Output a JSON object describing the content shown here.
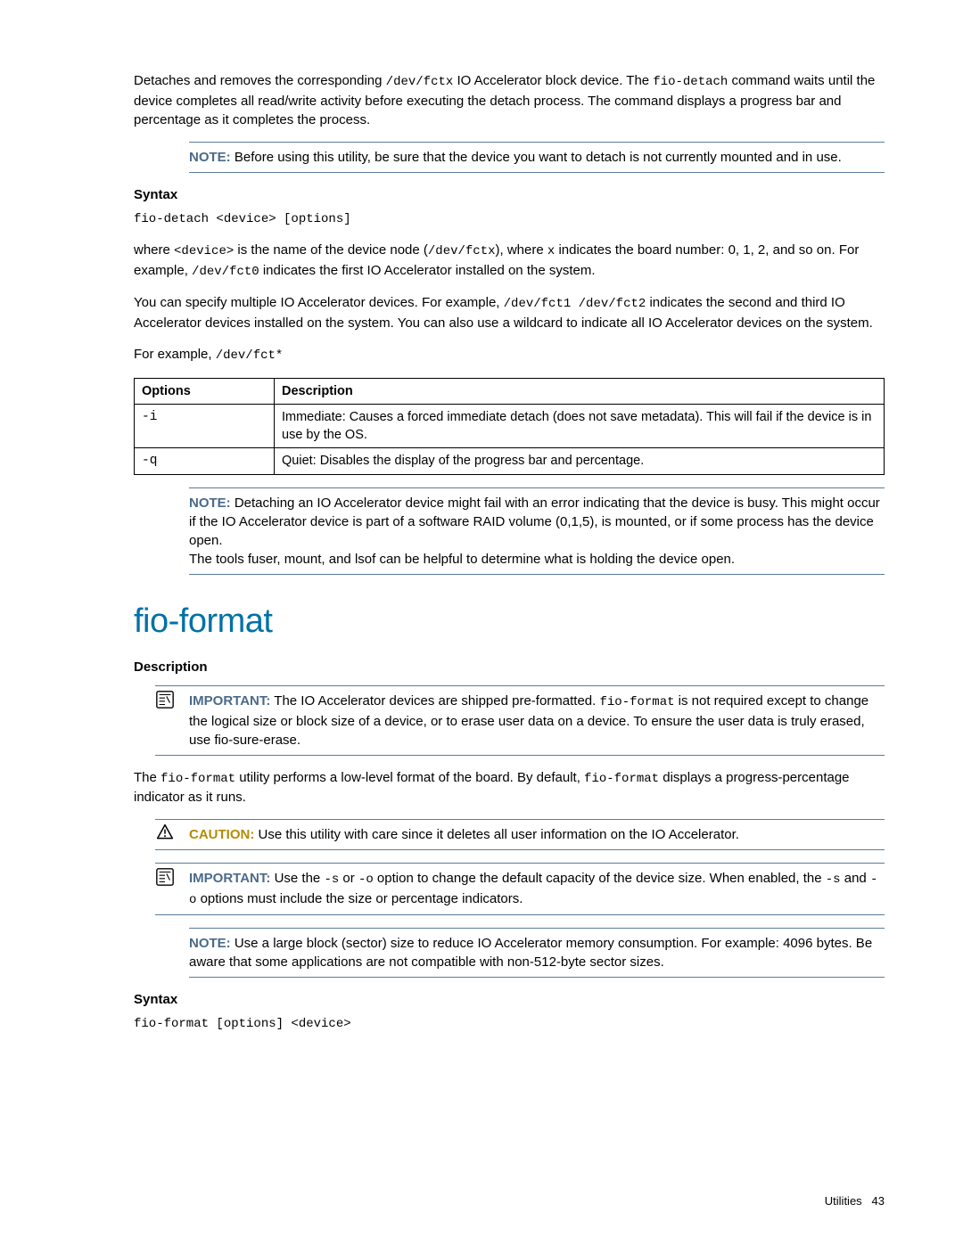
{
  "intro": {
    "p1a": "Detaches and removes the corresponding ",
    "p1_code1": "/dev/fctx",
    "p1b": " IO Accelerator block device. The ",
    "p1_code2": "fio-detach",
    "p1c": " command waits until the device completes all read/write activity before executing the detach process. The command displays a progress bar and percentage as it completes the process."
  },
  "note1": {
    "label": "NOTE:",
    "text": "Before using this utility, be sure that the device you want to detach is not currently mounted and in use."
  },
  "syntax_h": "Syntax",
  "syntax_code": "fio-detach <device> [options]",
  "where": {
    "a": "where ",
    "c1": "<device>",
    "b": " is the name of the device node (",
    "c2": "/dev/fctx",
    "c": "), where ",
    "c3": "x",
    "d": " indicates the board number: 0, 1, 2, and so on. For example, ",
    "c4": "/dev/fct0",
    "e": " indicates the first IO Accelerator installed on the system."
  },
  "multi": {
    "a": "You can specify multiple IO Accelerator devices. For example, ",
    "c1": "/dev/fct1 /dev/fct2",
    "b": " indicates the second and third IO Accelerator devices installed on the system. You can also use a wildcard to indicate all IO Accelerator devices on the system."
  },
  "ex": {
    "a": "For example, ",
    "c1": "/dev/fct*"
  },
  "table": {
    "h_opt": "Options",
    "h_desc": "Description",
    "rows": [
      {
        "opt": "-i",
        "desc": "Immediate: Causes a forced immediate detach (does not save metadata). This will fail if the device is in use by the OS."
      },
      {
        "opt": "-q",
        "desc": "Quiet: Disables the display of the progress bar and percentage."
      }
    ]
  },
  "note2": {
    "label": "NOTE:",
    "line1": "Detaching an IO Accelerator device might fail with an error indicating that the device is busy. This might occur if the IO Accelerator device is part of a software RAID volume (0,1,5), is mounted, or if some process has the device open.",
    "line2": "The tools fuser, mount, and lsof can be helpful to determine what is holding the device open."
  },
  "section_title": "fio-format",
  "desc_h": "Description",
  "important1": {
    "label": "IMPORTANT:",
    "a": "The IO Accelerator devices are shipped pre-formatted. ",
    "c1": "fio-format",
    "b": " is not required except to change the logical size or block size of a device, or to erase user data on a device. To ensure the user data is truly erased, use fio-sure-erase."
  },
  "fmt_para": {
    "a": "The ",
    "c1": "fio-format",
    "b": " utility performs a low-level format of the board. By default, ",
    "c2": "fio-format",
    "c": " displays a progress-percentage indicator as it runs."
  },
  "caution": {
    "label": "CAUTION:",
    "text": "Use this utility with care since it deletes all user information on the IO Accelerator."
  },
  "important2": {
    "label": "IMPORTANT:",
    "a": "Use the ",
    "c1": "-s",
    "b": " or ",
    "c2": "-o",
    "c": " option to change the default capacity of the device size. When enabled, the ",
    "c3": "-s",
    "d": " and ",
    "c4": "-o",
    "e": " options must include the size or percentage indicators."
  },
  "note3": {
    "label": "NOTE:",
    "text": "Use a large block (sector) size to reduce IO Accelerator memory consumption. For example: 4096 bytes. Be aware that some applications are not compatible with non-512-byte sector sizes."
  },
  "syntax2_h": "Syntax",
  "syntax2_code": "fio-format [options] <device>",
  "footer": {
    "section": "Utilities",
    "page": "43"
  }
}
